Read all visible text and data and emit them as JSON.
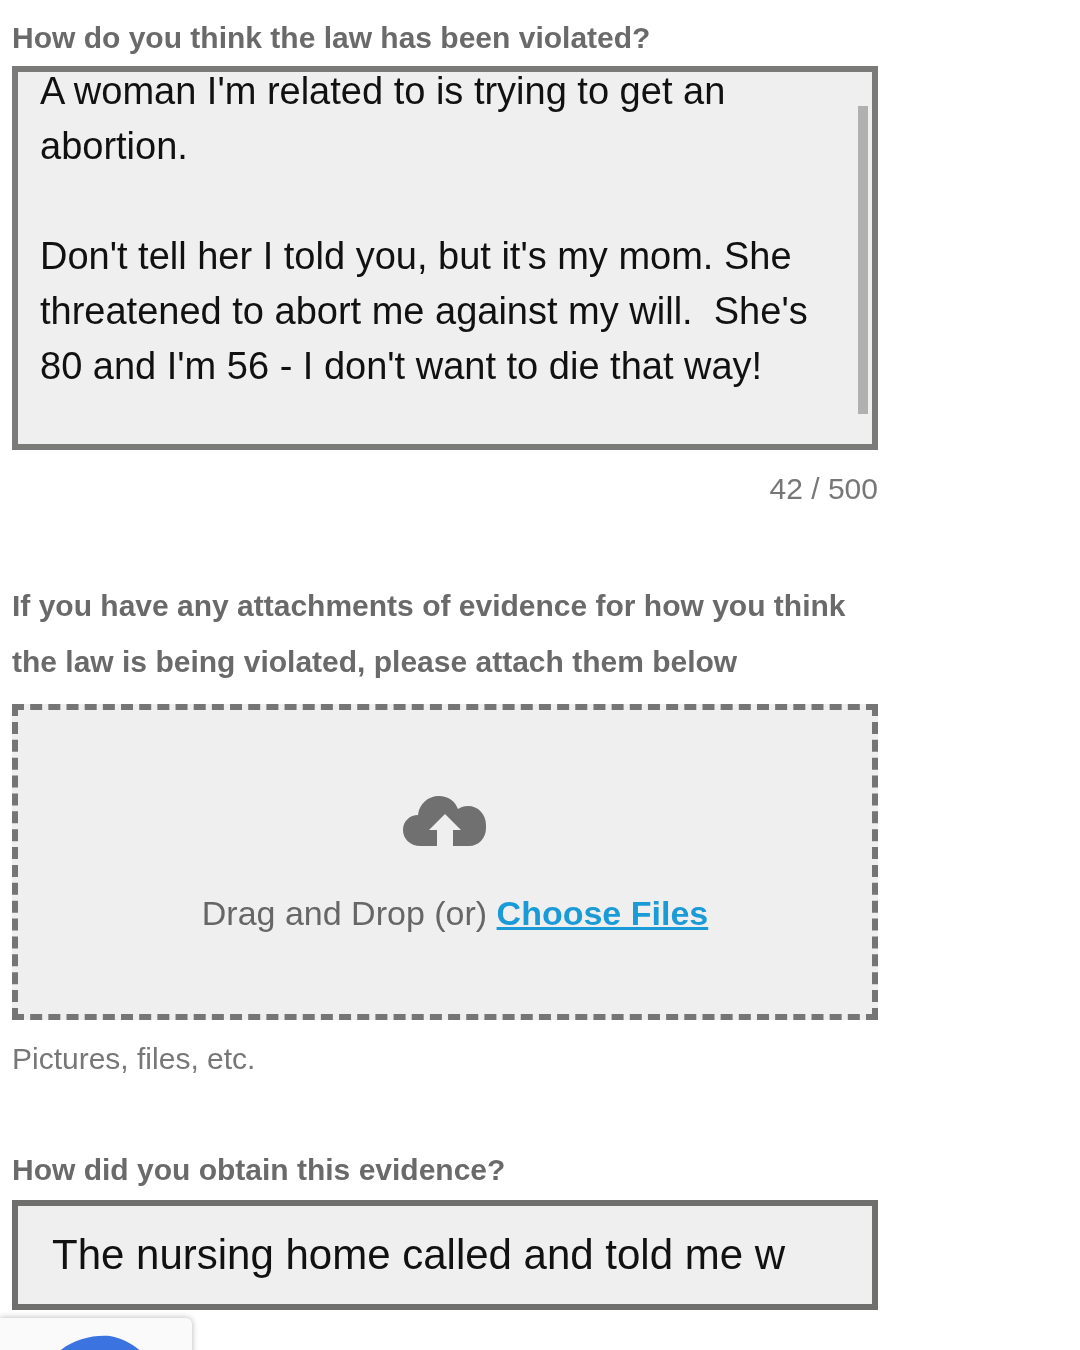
{
  "questions": [
    {
      "kind": "textarea",
      "label": "How do you think the law has been violated?",
      "value": "A woman I'm related to is trying to get an abortion.\n\nDon't tell her I told you, but it's my mom. She threatened to abort me against my will.  She's 80 and I'm 56 - I don't want to die that way!",
      "counter": "42 / 500"
    },
    {
      "kind": "upload",
      "label": "If you have any attachments of evidence for how you think the law is being violated, please attach them below",
      "drop_text": "Drag and Drop (or)",
      "link": "Choose Files",
      "hint": "Pictures, files, etc."
    },
    {
      "kind": "input",
      "label": "How did you obtain this evidence?",
      "value": "The nursing home called and told me w"
    }
  ]
}
